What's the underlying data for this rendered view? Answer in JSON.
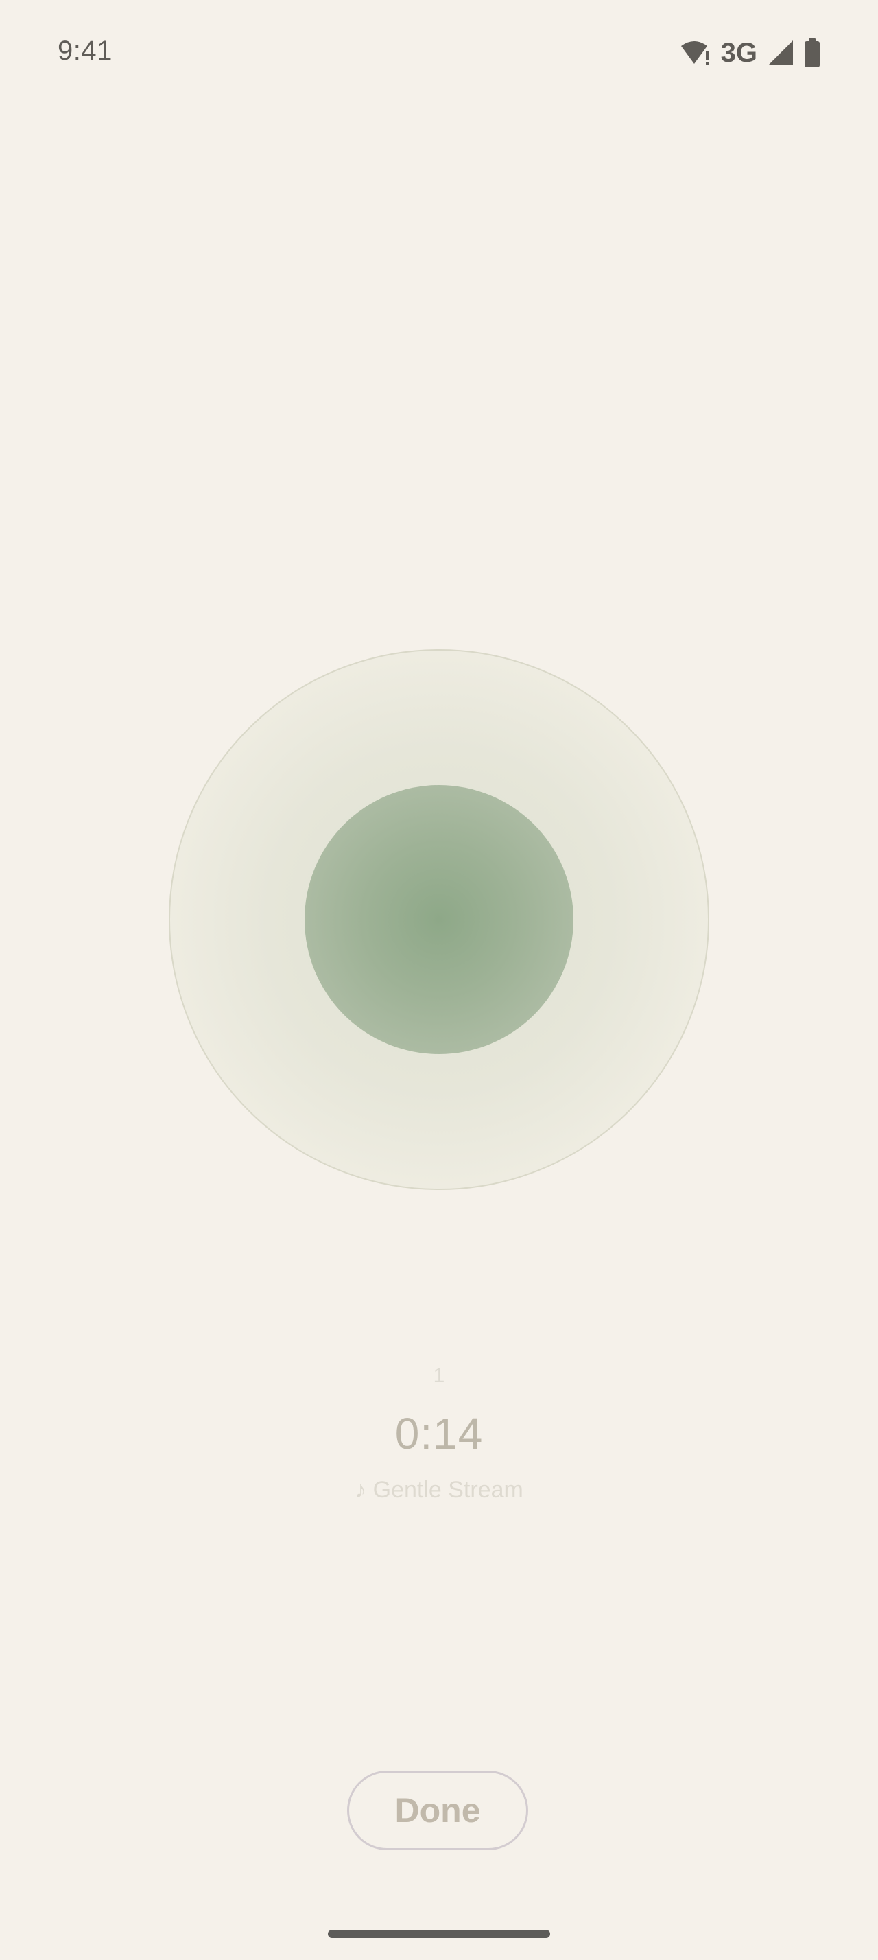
{
  "status_bar": {
    "time": "9:41",
    "network_type": "3G",
    "icons": [
      "wifi-alert-icon",
      "cell-signal-icon",
      "battery-icon"
    ]
  },
  "session": {
    "breath_count": "1",
    "timer": "0:14",
    "sound_label": "♪ Gentle Stream"
  },
  "actions": {
    "done_label": "Done"
  },
  "colors": {
    "background": "#f5f1ea",
    "orb_center": "#8ea888",
    "ring_border": "#d9d8c8",
    "timer_text": "#bdb7a9"
  }
}
